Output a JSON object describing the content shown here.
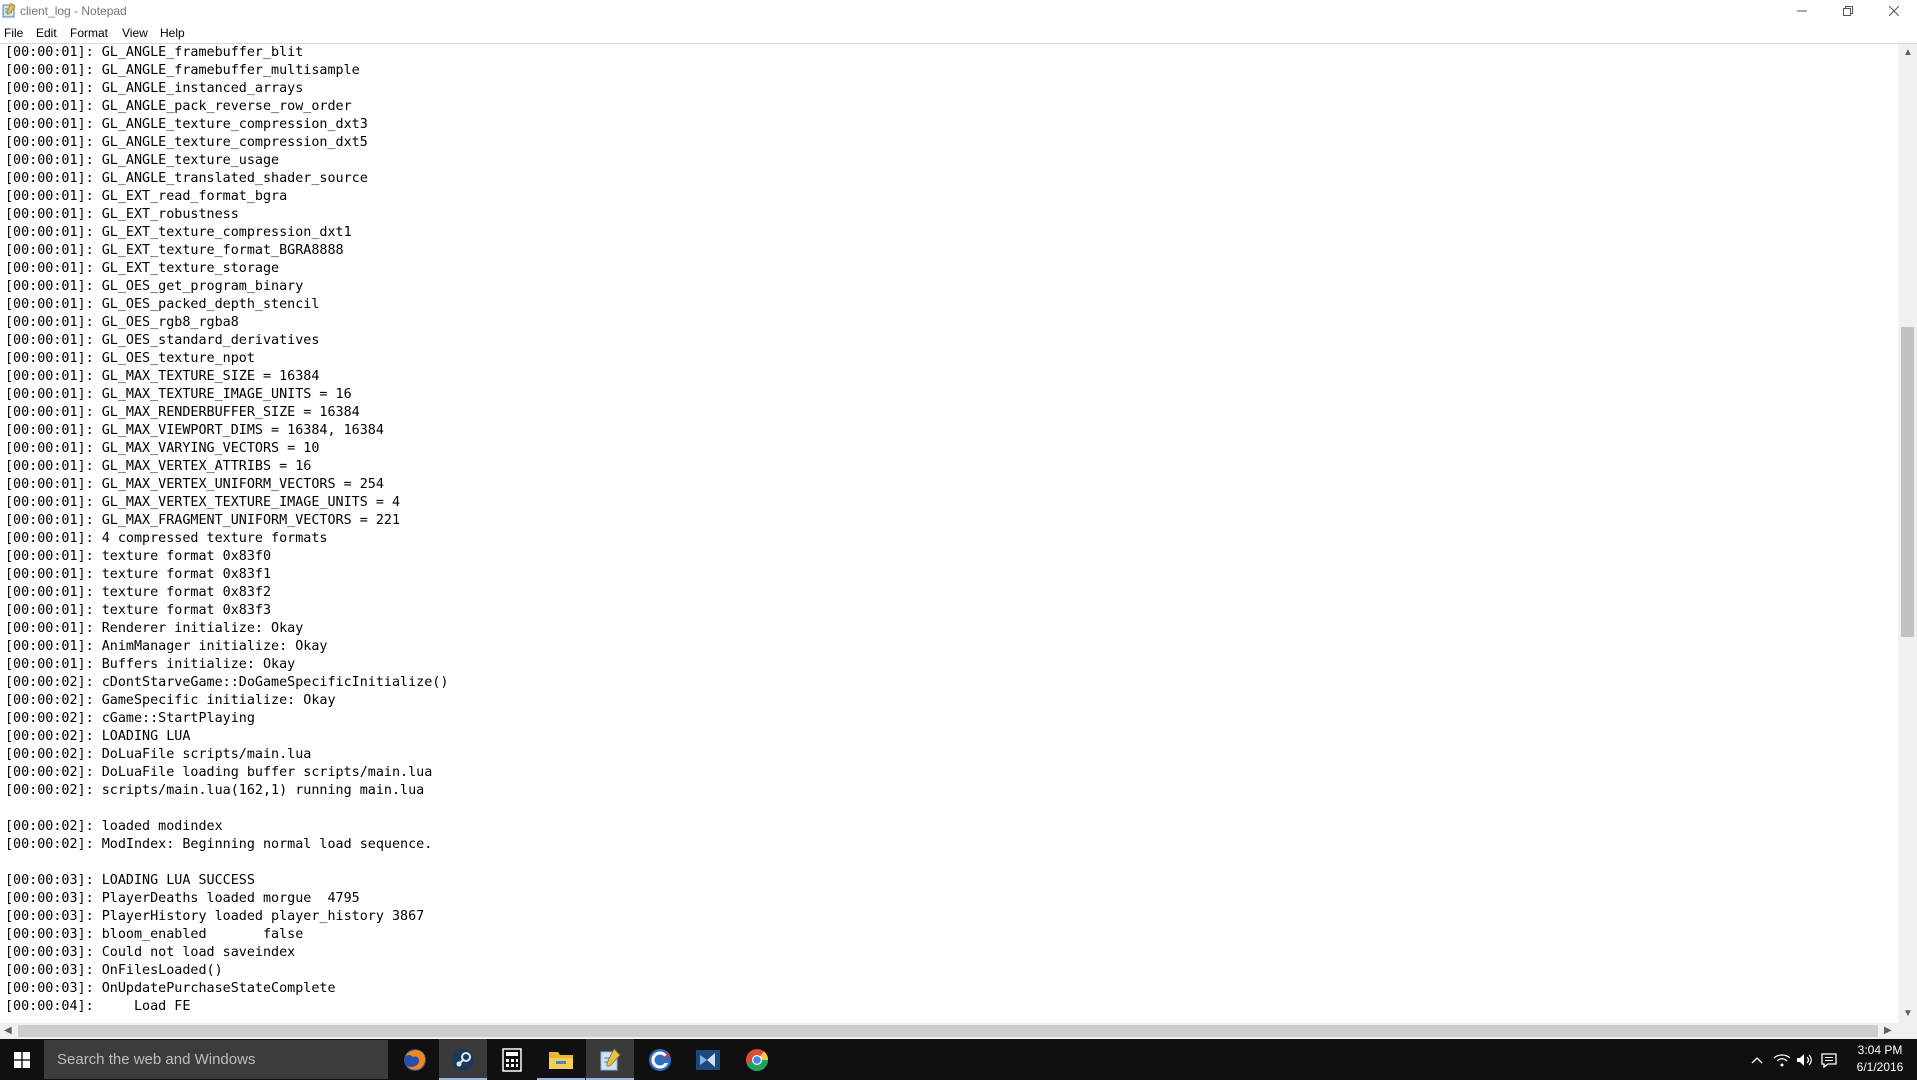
{
  "window": {
    "title": "client_log - Notepad"
  },
  "menu": [
    {
      "label": "File"
    },
    {
      "label": "Edit"
    },
    {
      "label": "Format"
    },
    {
      "label": "View"
    },
    {
      "label": "Help"
    }
  ],
  "log_lines": [
    "[00:00:01]: GL_ANGLE_framebuffer_blit",
    "[00:00:01]: GL_ANGLE_framebuffer_multisample",
    "[00:00:01]: GL_ANGLE_instanced_arrays",
    "[00:00:01]: GL_ANGLE_pack_reverse_row_order",
    "[00:00:01]: GL_ANGLE_texture_compression_dxt3",
    "[00:00:01]: GL_ANGLE_texture_compression_dxt5",
    "[00:00:01]: GL_ANGLE_texture_usage",
    "[00:00:01]: GL_ANGLE_translated_shader_source",
    "[00:00:01]: GL_EXT_read_format_bgra",
    "[00:00:01]: GL_EXT_robustness",
    "[00:00:01]: GL_EXT_texture_compression_dxt1",
    "[00:00:01]: GL_EXT_texture_format_BGRA8888",
    "[00:00:01]: GL_EXT_texture_storage",
    "[00:00:01]: GL_OES_get_program_binary",
    "[00:00:01]: GL_OES_packed_depth_stencil",
    "[00:00:01]: GL_OES_rgb8_rgba8",
    "[00:00:01]: GL_OES_standard_derivatives",
    "[00:00:01]: GL_OES_texture_npot",
    "[00:00:01]: GL_MAX_TEXTURE_SIZE = 16384",
    "[00:00:01]: GL_MAX_TEXTURE_IMAGE_UNITS = 16",
    "[00:00:01]: GL_MAX_RENDERBUFFER_SIZE = 16384",
    "[00:00:01]: GL_MAX_VIEWPORT_DIMS = 16384, 16384",
    "[00:00:01]: GL_MAX_VARYING_VECTORS = 10",
    "[00:00:01]: GL_MAX_VERTEX_ATTRIBS = 16",
    "[00:00:01]: GL_MAX_VERTEX_UNIFORM_VECTORS = 254",
    "[00:00:01]: GL_MAX_VERTEX_TEXTURE_IMAGE_UNITS = 4",
    "[00:00:01]: GL_MAX_FRAGMENT_UNIFORM_VECTORS = 221",
    "[00:00:01]: 4 compressed texture formats",
    "[00:00:01]: texture format 0x83f0",
    "[00:00:01]: texture format 0x83f1",
    "[00:00:01]: texture format 0x83f2",
    "[00:00:01]: texture format 0x83f3",
    "[00:00:01]: Renderer initialize: Okay",
    "[00:00:01]: AnimManager initialize: Okay",
    "[00:00:01]: Buffers initialize: Okay",
    "[00:00:02]: cDontStarveGame::DoGameSpecificInitialize()",
    "[00:00:02]: GameSpecific initialize: Okay",
    "[00:00:02]: cGame::StartPlaying",
    "[00:00:02]: LOADING LUA",
    "[00:00:02]: DoLuaFile scripts/main.lua",
    "[00:00:02]: DoLuaFile loading buffer scripts/main.lua",
    "[00:00:02]: scripts/main.lua(162,1) running main.lua",
    "",
    "[00:00:02]: loaded modindex",
    "[00:00:02]: ModIndex: Beginning normal load sequence.",
    "",
    "[00:00:03]: LOADING LUA SUCCESS",
    "[00:00:03]: PlayerDeaths loaded morgue  4795",
    "[00:00:03]: PlayerHistory loaded player_history 3867",
    "[00:00:03]: bloom_enabled       false",
    "[00:00:03]: Could not load saveindex",
    "[00:00:03]: OnFilesLoaded()",
    "[00:00:03]: OnUpdatePurchaseStateComplete",
    "[00:00:04]:     Load FE"
  ],
  "taskbar": {
    "search_placeholder": "Search the web and Windows",
    "apps": [
      {
        "icon": "firefox-icon"
      },
      {
        "icon": "steam-icon"
      },
      {
        "icon": "calculator-icon"
      },
      {
        "icon": "file-explorer-icon"
      },
      {
        "icon": "notepad-icon"
      },
      {
        "icon": "ccleaner-icon"
      },
      {
        "icon": "visual-studio-icon"
      },
      {
        "icon": "chrome-icon"
      }
    ],
    "clock": {
      "time": "3:04 PM",
      "date": "6/1/2016"
    }
  },
  "colors": {
    "taskbar": "#101010",
    "search_box": "#3c3c3c",
    "active_app": "#3a3a3a"
  }
}
